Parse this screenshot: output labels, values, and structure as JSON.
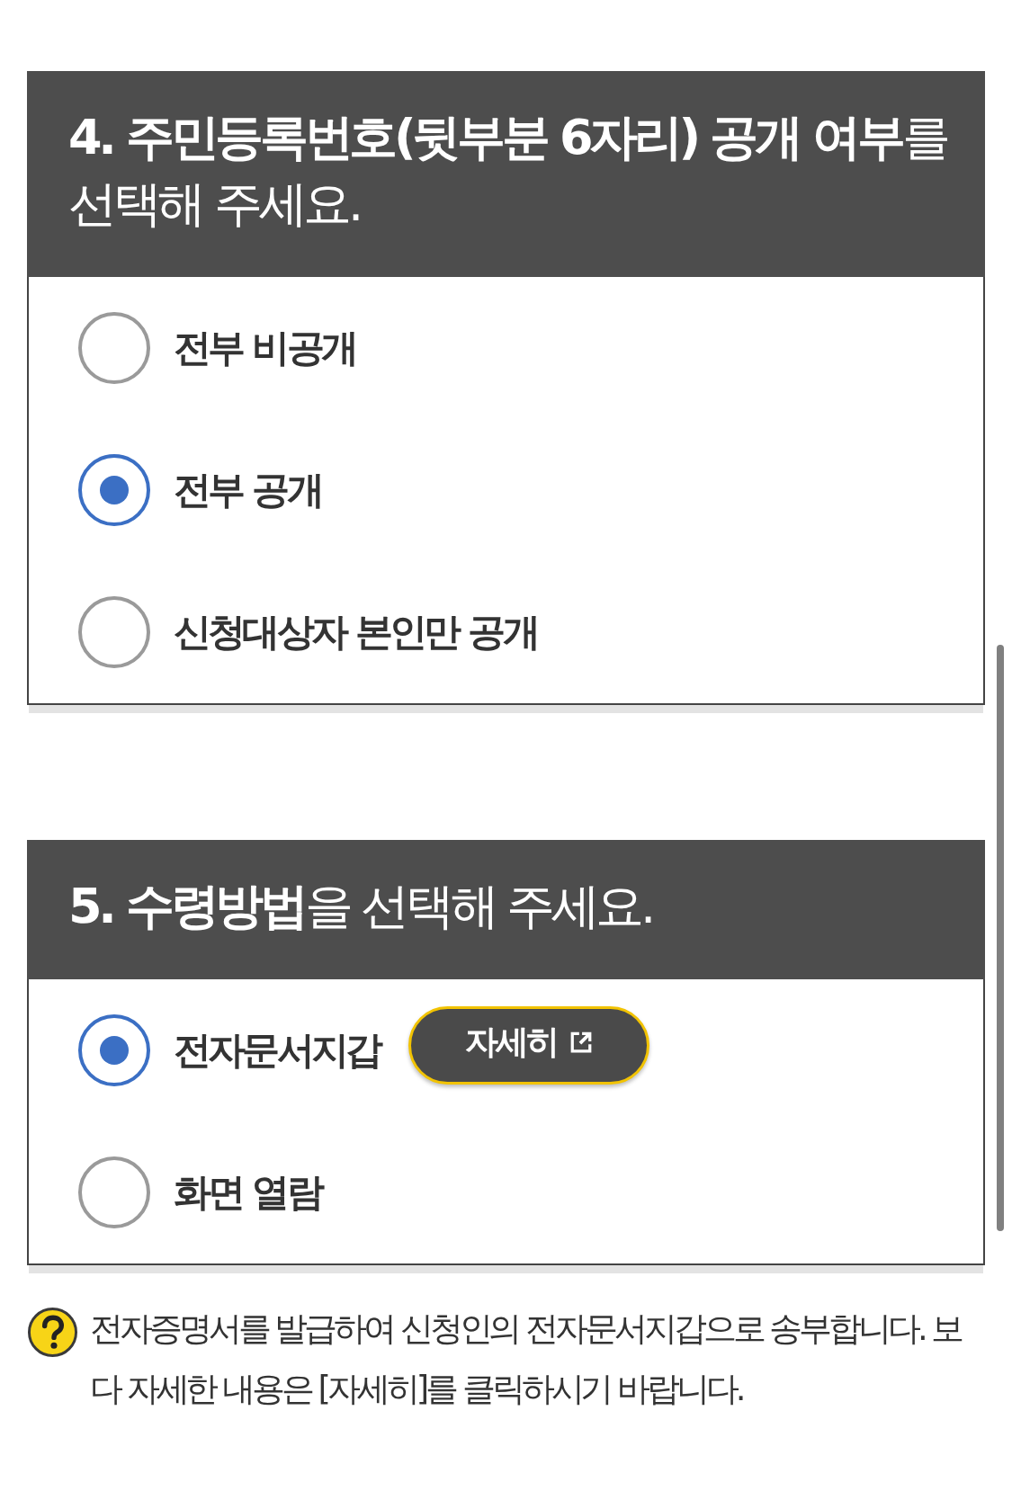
{
  "questions": [
    {
      "title": "**4. 주민등록번호(뒷부분 6자리) 공개 여부**를 선택해 주세요.",
      "options": [
        {
          "label": "전부 비공개",
          "selected": false
        },
        {
          "label": "전부 공개",
          "selected": true
        },
        {
          "label": "신청대상자 본인만 공개",
          "selected": false
        }
      ]
    },
    {
      "title": "**5. 수령방법**을 선택해 주세요.",
      "options": [
        {
          "label": "전자문서지갑",
          "selected": true,
          "button": {
            "label": "자세히"
          }
        },
        {
          "label": "화면 열람",
          "selected": false
        }
      ]
    }
  ],
  "note": {
    "text": "전자증명서를 발급하여 신청인의 전자문서지갑으로 송부합니다. 보다 자세한 내용은 [자세히]를 클릭하시기 바랍니다."
  }
}
